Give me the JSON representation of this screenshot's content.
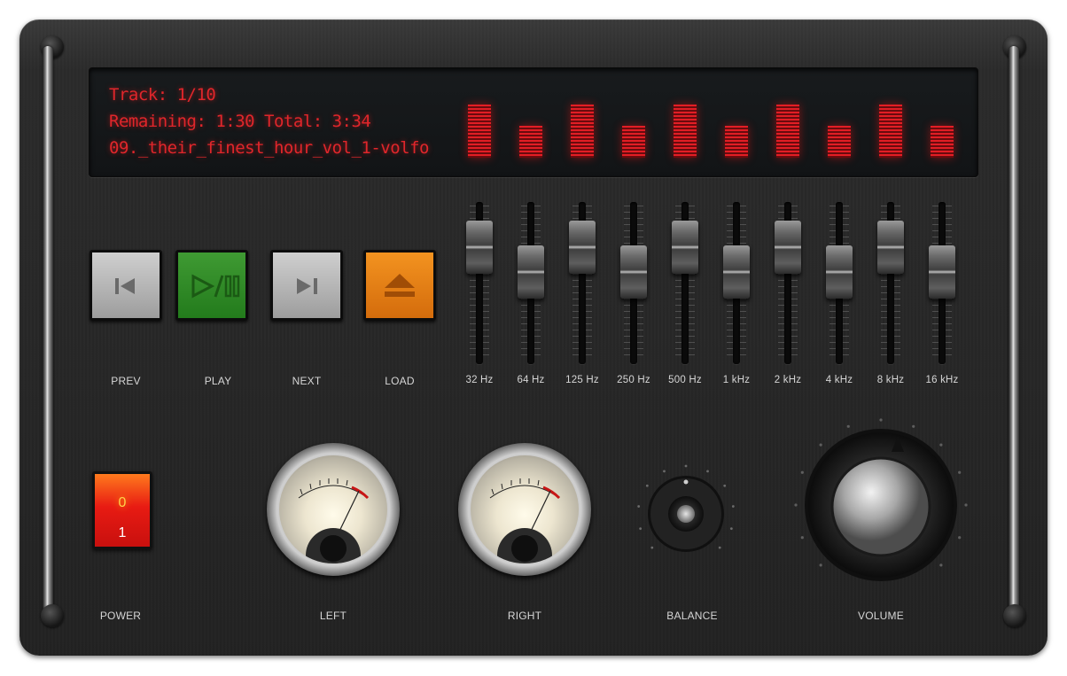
{
  "display": {
    "track": "Track: 1/10",
    "remaining": "Remaining: 1:30  Total: 3:34",
    "filename": "09._their_finest_hour_vol_1-volfo",
    "color": "#e0262b",
    "spectrum_levels": [
      1.0,
      0.6,
      1.0,
      0.6,
      1.0,
      0.6,
      1.0,
      0.6,
      1.0,
      0.6
    ]
  },
  "transport": {
    "prev": "PREV",
    "play": "PLAY",
    "next": "NEXT",
    "load": "LOAD",
    "prev_icon": "skip-back-icon",
    "play_icon": "play-pause-icon",
    "next_icon": "skip-forward-icon",
    "load_icon": "eject-icon"
  },
  "equalizer": {
    "bands": [
      "32 Hz",
      "64 Hz",
      "125 Hz",
      "250 Hz",
      "500 Hz",
      "1 kHz",
      "2 kHz",
      "4 kHz",
      "8 kHz",
      "16 kHz"
    ],
    "levels": [
      0.83,
      0.6,
      0.83,
      0.6,
      0.83,
      0.6,
      0.83,
      0.6,
      0.83,
      0.6
    ]
  },
  "controls": {
    "power": "POWER",
    "power_off": "0",
    "power_on": "1",
    "left": "LEFT",
    "right": "RIGHT",
    "balance": "BALANCE",
    "volume": "VOLUME"
  }
}
